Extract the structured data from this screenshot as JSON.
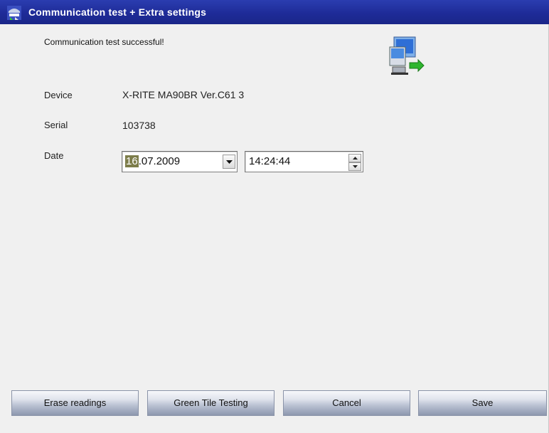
{
  "window": {
    "title": "Communication test + Extra settings"
  },
  "status": {
    "message": "Communication test successful!"
  },
  "device": {
    "label": "Device",
    "value": "X-RITE MA90BR Ver.C61 3"
  },
  "serial": {
    "label": "Serial",
    "value": "103738"
  },
  "date": {
    "label": "Date",
    "day": "16",
    "rest": ".07.2009",
    "time": "14:24:44"
  },
  "buttons": {
    "erase": "Erase readings",
    "green_tile": "Green Tile Testing",
    "cancel": "Cancel",
    "save": "Save"
  },
  "icons": {
    "title": "app-icon",
    "network": "network-computers-icon",
    "dropdown": "chevron-down-icon",
    "spin_up": "spin-up-icon",
    "spin_down": "spin-down-icon"
  },
  "colors": {
    "titlebar": "#1e2b98",
    "selection": "#7d7d4a"
  }
}
